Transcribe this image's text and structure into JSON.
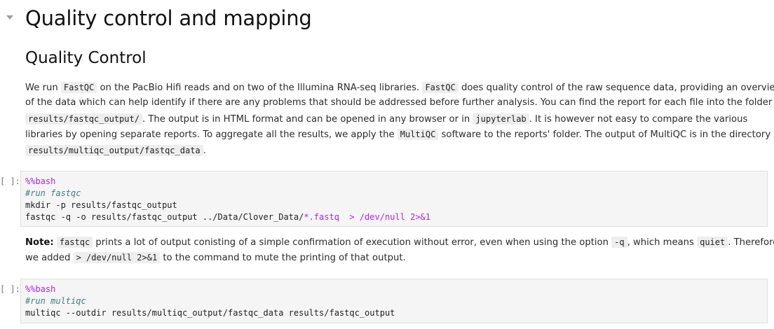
{
  "heading1": "Quality control and mapping",
  "heading2": "Quality Control",
  "para1": {
    "l1a": "We run ",
    "l1c1": "FastQC",
    "l1b": " on the PacBio Hifi reads and on two of the Illumina RNA-seq libraries. ",
    "l1c2": "FastQC",
    "l1c": " does quality control of the raw sequence data, providing an overview",
    "l2": "of the data which can help identify if there are any problems that should be addressed before further analysis. You can find the report for each file into the folder",
    "l3c1": "results/fastqc_output/",
    "l3a": ". The output is in HTML format and can be opened in any browser or in ",
    "l3c2": "jupyterlab",
    "l3b": ". It is however not easy to compare the various",
    "l4a": "libraries by opening separate reports. To aggregate all the results, we apply the ",
    "l4c1": "MultiQC",
    "l4b": " software to the reports' folder. The output of MultiQC is in the directory",
    "l5c1": "results/multiqc_output/fastqc_data",
    "l5a": "."
  },
  "cell1": {
    "prompt": "[ ]:",
    "line1": "%%bash",
    "line2": "#run fastqc",
    "line3": "mkdir -p results/fastqc_output",
    "line4a": "fastqc -q -o results/fastqc_output ../Data/Clover_Data/",
    "line4b": "*.fastq",
    "line4c": "  > /dev/null ",
    "line4d": "2>&1"
  },
  "note": {
    "bold": "Note:",
    "c1": "fastqc",
    "a": " prints a lot of output conisting of a simple confirmation of execution without error, even when using the option ",
    "c2": "-q",
    "b": ", which means ",
    "c3": "quiet",
    "c": ". Therefore",
    "l2a": "we added ",
    "c4": "> /dev/null 2>&1",
    "l2b": " to the command to mute the printing of that output."
  },
  "cell2": {
    "prompt": "[ ]:",
    "line1": "%%bash",
    "line2": "#run multiqc",
    "line3": "multiqc --outdir results/multiqc_output/fastqc_data results/fastqc_output"
  }
}
